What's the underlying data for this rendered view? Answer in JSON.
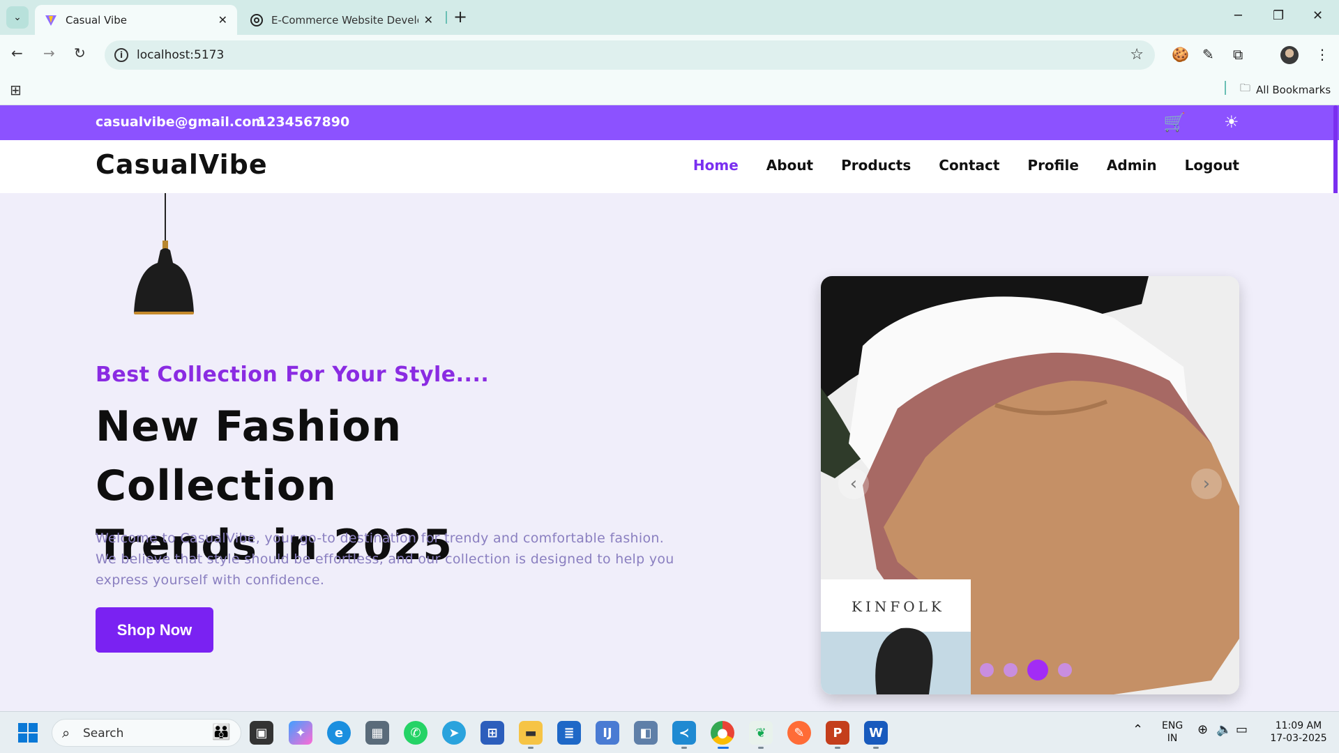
{
  "browser": {
    "tabs": [
      {
        "title": "Casual Vibe",
        "active": true
      },
      {
        "title": "E-Commerce Website Developm",
        "active": false
      }
    ],
    "url": "localhost:5173",
    "bookmarks_label": "All Bookmarks"
  },
  "site": {
    "contact": {
      "email": "casualvibe@gmail.com",
      "phone": "1234567890"
    },
    "brand": "CasualVibe",
    "nav": [
      "Home",
      "About",
      "Products",
      "Contact",
      "Profile",
      "Admin",
      "Logout"
    ],
    "active_nav": "Home",
    "hero": {
      "subtitle": "Best Collection For Your Style....",
      "headline_line1": "New Fashion Collection",
      "headline_line2": "Trends in 2025",
      "description": "Welcome to CasualVibe, your go-to destination for trendy and comfortable fashion. We believe that style should be effortless, and our collection is designed to help you express yourself with confidence.",
      "cta": "Shop Now"
    },
    "carousel": {
      "image_text": "KINFOLK",
      "slide_count": 4,
      "active_slide": 3
    }
  },
  "taskbar": {
    "search_label": "Search",
    "language": "ENG",
    "region": "IN",
    "time": "11:09 AM",
    "date": "17-03-2025"
  },
  "colors": {
    "brand_purple": "#8c52ff",
    "accent_purple": "#7a22f2"
  }
}
